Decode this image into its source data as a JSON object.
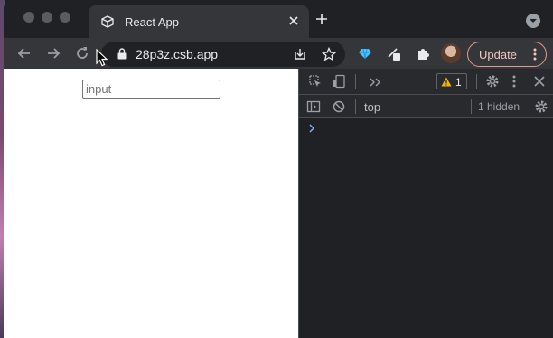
{
  "browser": {
    "tab": {
      "title": "React App"
    },
    "address_bar": {
      "url": "28p3z.csb.app"
    },
    "update_button": {
      "label": "Update"
    }
  },
  "page": {
    "input": {
      "placeholder": "input",
      "value": ""
    }
  },
  "devtools": {
    "warning_count": "1",
    "context_selector": "top",
    "hidden_messages": "1 hidden"
  },
  "colors": {
    "update_border": "#e8998e",
    "warning": "#f2b600",
    "prompt": "#7cacf8"
  }
}
